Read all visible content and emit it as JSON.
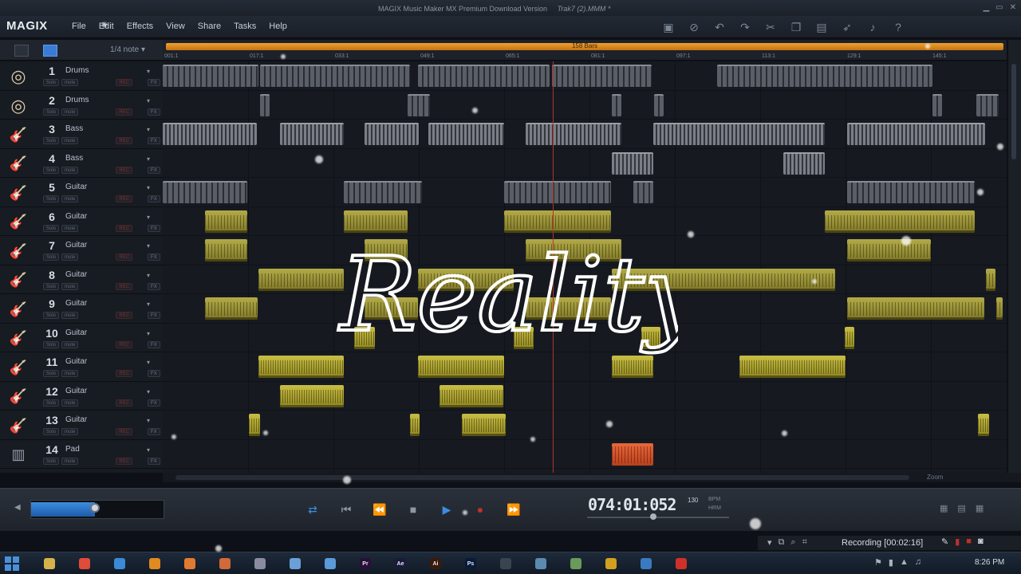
{
  "window": {
    "title": "MAGIX Music Maker MX Premium Download Version",
    "file": "Trak7 (2).MMM *"
  },
  "menubar": {
    "logo": "MAGIX",
    "items": [
      "File",
      "Edit",
      "Effects",
      "View",
      "Share",
      "Tasks",
      "Help"
    ]
  },
  "toolbar": {
    "icons": [
      "save-icon",
      "no-icon",
      "undo-icon",
      "redo-icon",
      "cut-icon",
      "copy-icon",
      "paste-icon",
      "cursor-icon",
      "note-icon",
      "help-icon"
    ]
  },
  "header_strip": {
    "snap": "1/4 note"
  },
  "ruler": {
    "loop_label": "158 Bars",
    "ticks": [
      "001:1",
      "017:1",
      "033:1",
      "049:1",
      "065:1",
      "081:1",
      "097:1",
      "113:1",
      "129:1",
      "145:1"
    ]
  },
  "tracks": [
    {
      "num": "1",
      "name": "Drums",
      "type": "drums",
      "color": "#d9c8a6"
    },
    {
      "num": "2",
      "name": "Drums",
      "type": "drums",
      "color": "#d9c8a6"
    },
    {
      "num": "3",
      "name": "Bass",
      "type": "bass",
      "color": "#c96a2a"
    },
    {
      "num": "4",
      "name": "Bass",
      "type": "bass",
      "color": "#c96a2a"
    },
    {
      "num": "5",
      "name": "Guitar",
      "type": "guitar",
      "color": "#d23a1c"
    },
    {
      "num": "6",
      "name": "Guitar",
      "type": "guitar",
      "color": "#d23a1c"
    },
    {
      "num": "7",
      "name": "Guitar",
      "type": "guitar",
      "color": "#d23a1c"
    },
    {
      "num": "8",
      "name": "Guitar",
      "type": "guitar",
      "color": "#d23a1c"
    },
    {
      "num": "9",
      "name": "Guitar",
      "type": "guitar",
      "color": "#d23a1c"
    },
    {
      "num": "10",
      "name": "Guitar",
      "type": "guitar",
      "color": "#d23a1c"
    },
    {
      "num": "11",
      "name": "Guitar",
      "type": "guitar",
      "color": "#d23a1c"
    },
    {
      "num": "12",
      "name": "Guitar",
      "type": "guitar",
      "color": "#d23a1c"
    },
    {
      "num": "13",
      "name": "Guitar",
      "type": "guitar",
      "color": "#d23a1c"
    },
    {
      "num": "14",
      "name": "Pad",
      "type": "pad",
      "color": "#9aa2ad"
    }
  ],
  "track_buttons": {
    "solo": "Solo",
    "mute": "mute",
    "rec": "REC",
    "fx": "FX"
  },
  "clips": [
    [
      [
        "drum",
        0,
        120
      ],
      [
        "drum",
        122,
        188
      ],
      [
        "drum",
        320,
        165
      ],
      [
        "drum",
        488,
        125
      ],
      [
        "drum",
        695,
        270
      ]
    ],
    [
      [
        "drum",
        122,
        12
      ],
      [
        "drum",
        307,
        28
      ],
      [
        "drum",
        563,
        12
      ],
      [
        "drum",
        616,
        12
      ],
      [
        "drum",
        965,
        12
      ],
      [
        "drum",
        1020,
        28
      ]
    ],
    [
      [
        "bass",
        0,
        118
      ],
      [
        "bass",
        147,
        80
      ],
      [
        "bass",
        253,
        68
      ],
      [
        "bass",
        333,
        95
      ],
      [
        "bass",
        455,
        120
      ],
      [
        "bass",
        615,
        215
      ],
      [
        "bass",
        858,
        173
      ]
    ],
    [
      [
        "bass",
        563,
        52
      ],
      [
        "bass",
        778,
        52
      ]
    ],
    [
      [
        "drum",
        0,
        106
      ],
      [
        "drum",
        227,
        98
      ],
      [
        "drum",
        428,
        134
      ],
      [
        "drum",
        590,
        25
      ],
      [
        "drum",
        858,
        160
      ]
    ],
    [
      [
        "gtr",
        53,
        53
      ],
      [
        "gtr",
        227,
        80
      ],
      [
        "gtr",
        428,
        134
      ],
      [
        "gtr",
        830,
        188
      ]
    ],
    [
      [
        "gtr",
        53,
        53
      ],
      [
        "gtr",
        253,
        54
      ],
      [
        "gtr",
        455,
        120
      ],
      [
        "gtr",
        858,
        105
      ]
    ],
    [
      [
        "gtr",
        120,
        107
      ],
      [
        "gtr",
        320,
        120
      ],
      [
        "gtr",
        563,
        280
      ],
      [
        "gtr",
        1032,
        12
      ]
    ],
    [
      [
        "gtr",
        53,
        66
      ],
      [
        "gtr",
        253,
        67
      ],
      [
        "gtr",
        455,
        107
      ],
      [
        "gtr",
        858,
        172
      ],
      [
        "gtr",
        1045,
        8
      ]
    ],
    [
      [
        "gtr2",
        240,
        26
      ],
      [
        "gtr2",
        440,
        25
      ],
      [
        "gtr2",
        600,
        24
      ],
      [
        "gtr2",
        855,
        12
      ]
    ],
    [
      [
        "gtr2",
        120,
        107
      ],
      [
        "gtr2",
        320,
        108
      ],
      [
        "gtr2",
        563,
        52
      ],
      [
        "gtr2",
        723,
        133
      ]
    ],
    [
      [
        "gtr2",
        147,
        80
      ],
      [
        "gtr2",
        347,
        80
      ]
    ],
    [
      [
        "gtr2",
        108,
        14
      ],
      [
        "gtr2",
        310,
        12
      ],
      [
        "gtr2",
        375,
        55
      ],
      [
        "gtr2",
        1022,
        14
      ]
    ],
    [
      [
        "pad",
        563,
        52
      ]
    ]
  ],
  "overlay": {
    "text": "Reality"
  },
  "transport": {
    "time": "074:01:052",
    "bpm_value": "130",
    "bpm_label": "BPM",
    "hrm_label": "HRM",
    "volume": 0.48
  },
  "hscroll": {
    "zoom_label": "Zoom"
  },
  "recorder": {
    "label": "Recording [00:02:16]"
  },
  "taskbar": {
    "apps": [
      {
        "icon": "folder-icon",
        "color": "#d6b24a",
        "text": ""
      },
      {
        "icon": "chrome-icon",
        "color": "#e04b3a",
        "text": ""
      },
      {
        "icon": "ie-icon",
        "color": "#3a8ad6",
        "text": ""
      },
      {
        "icon": "media-icon",
        "color": "#e08a20",
        "text": ""
      },
      {
        "icon": "app-icon",
        "color": "#e07a30",
        "text": ""
      },
      {
        "icon": "books-icon",
        "color": "#d06a3a",
        "text": ""
      },
      {
        "icon": "disc-icon",
        "color": "#8a8aa0",
        "text": ""
      },
      {
        "icon": "window-icon",
        "color": "#6aa0d6",
        "text": ""
      },
      {
        "icon": "editor-icon",
        "color": "#5a9ad6",
        "text": ""
      },
      {
        "icon": "premiere-icon",
        "color": "#2a0f3a",
        "text": "Pr"
      },
      {
        "icon": "aftereffects-icon",
        "color": "#1a1a3a",
        "text": "Ae"
      },
      {
        "icon": "illustrator-icon",
        "color": "#3a1a0a",
        "text": "Ai"
      },
      {
        "icon": "photoshop-icon",
        "color": "#0a1a3a",
        "text": "Ps"
      },
      {
        "icon": "film-icon",
        "color": "#3a4450",
        "text": ""
      },
      {
        "icon": "monitor-icon",
        "color": "#5a8ab0",
        "text": ""
      },
      {
        "icon": "recycle-icon",
        "color": "#6a9a5a",
        "text": ""
      },
      {
        "icon": "audio-icon",
        "color": "#d0a020",
        "text": ""
      },
      {
        "icon": "magix-icon",
        "color": "#3a7ac0",
        "text": ""
      },
      {
        "icon": "record-icon",
        "color": "#d0302a",
        "text": ""
      }
    ],
    "clock": "8:26 PM"
  }
}
